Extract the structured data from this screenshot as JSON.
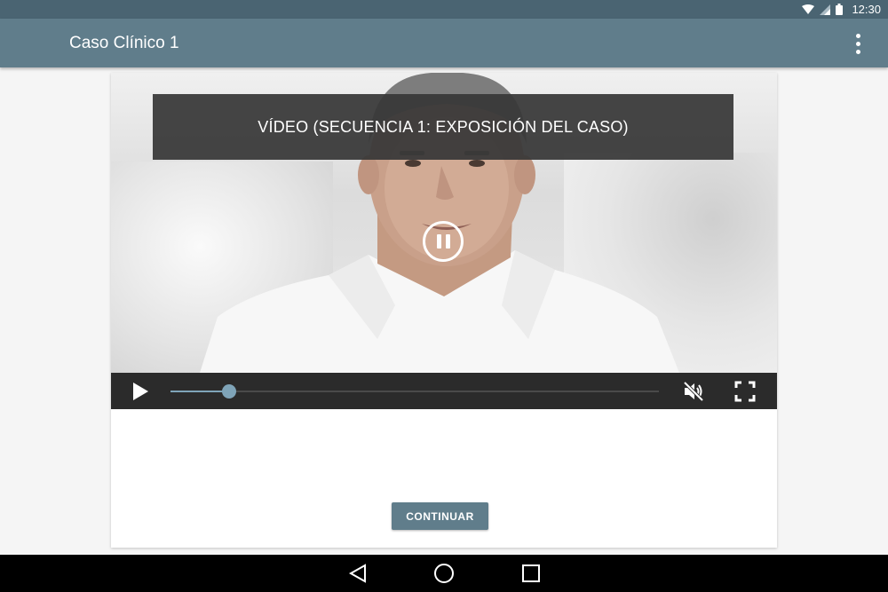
{
  "status_bar": {
    "time": "12:30",
    "icons": [
      "wifi-icon",
      "signal-icon",
      "battery-icon"
    ]
  },
  "app_bar": {
    "title": "Caso Clínico 1",
    "menu_icon": "more-vert-icon"
  },
  "video": {
    "title": "VÍDEO (SECUENCIA 1: EXPOSICIÓN DEL CASO)",
    "progress": 0.12,
    "muted": true,
    "state_icon": "pause-icon",
    "controls": [
      "play-icon",
      "mute-icon",
      "fullscreen-icon"
    ]
  },
  "actions": {
    "continue_label": "CONTINUAR"
  },
  "navigation": {
    "buttons": [
      "back-icon",
      "home-icon",
      "recents-icon"
    ]
  },
  "colors": {
    "status_bar": "#4a6472",
    "app_bar": "#607d8b",
    "accent": "#7fa4b8",
    "controls_bg": "#2b2b2b",
    "button": "#607d8b"
  }
}
